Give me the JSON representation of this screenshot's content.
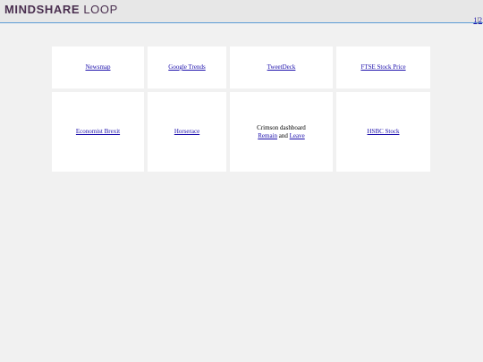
{
  "header": {
    "logo_bold": "MINDSHARE",
    "logo_light": "LOOP"
  },
  "pager": {
    "page1": "1",
    "separator": "|",
    "page2": "2"
  },
  "tiles": [
    {
      "label": "Newsmap"
    },
    {
      "label": "Google Trends"
    },
    {
      "label": "TweetDeck"
    },
    {
      "label": "FTSE Stock Price"
    },
    {
      "label": "Economist Brexit"
    },
    {
      "label": "Horserace"
    },
    {
      "title": "Crimson dashboard",
      "link1": "Remain",
      "joiner": "and",
      "link2": "Leave"
    },
    {
      "label": "HSBC Stock"
    }
  ]
}
